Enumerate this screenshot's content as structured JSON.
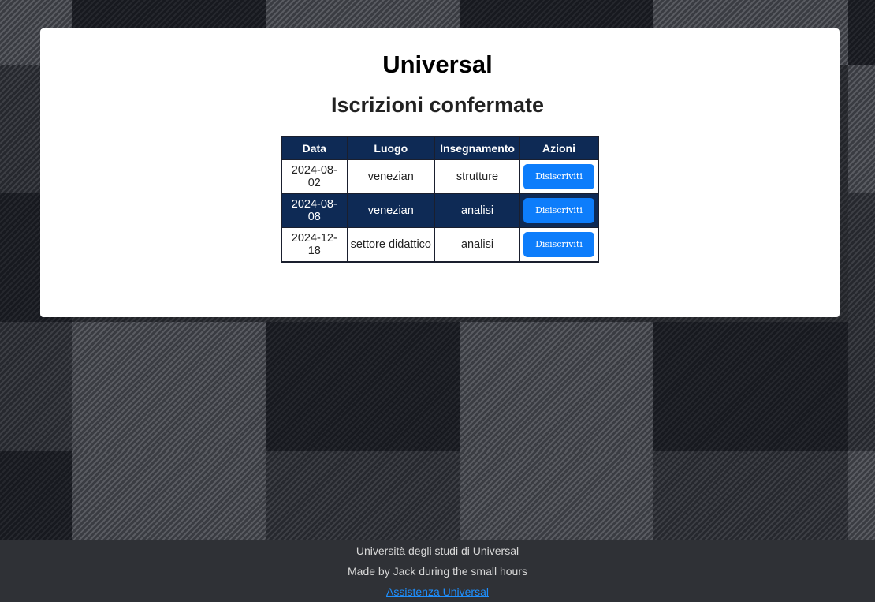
{
  "header": {
    "site_title": "Universal",
    "section_title": "Iscrizioni confermate"
  },
  "table": {
    "columns": [
      "Data",
      "Luogo",
      "Insegnamento",
      "Azioni"
    ],
    "rows": [
      {
        "data": "2024-08-02",
        "luogo": "venezian",
        "insegnamento": "strutture",
        "azione": "Disiscriviti"
      },
      {
        "data": "2024-08-08",
        "luogo": "venezian",
        "insegnamento": "analisi",
        "azione": "Disiscriviti"
      },
      {
        "data": "2024-12-18",
        "luogo": "settore didattico",
        "insegnamento": "analisi",
        "azione": "Disiscriviti"
      }
    ]
  },
  "footer": {
    "university": "Università degli studi di Universal",
    "credits": "Made by Jack during the small hours",
    "support_link": "Assistenza Universal"
  },
  "colors": {
    "header_bg": "#0e2a55",
    "button_bg": "#0d7dfb",
    "link": "#1e90ff",
    "footer_bg": "#2f3136"
  }
}
